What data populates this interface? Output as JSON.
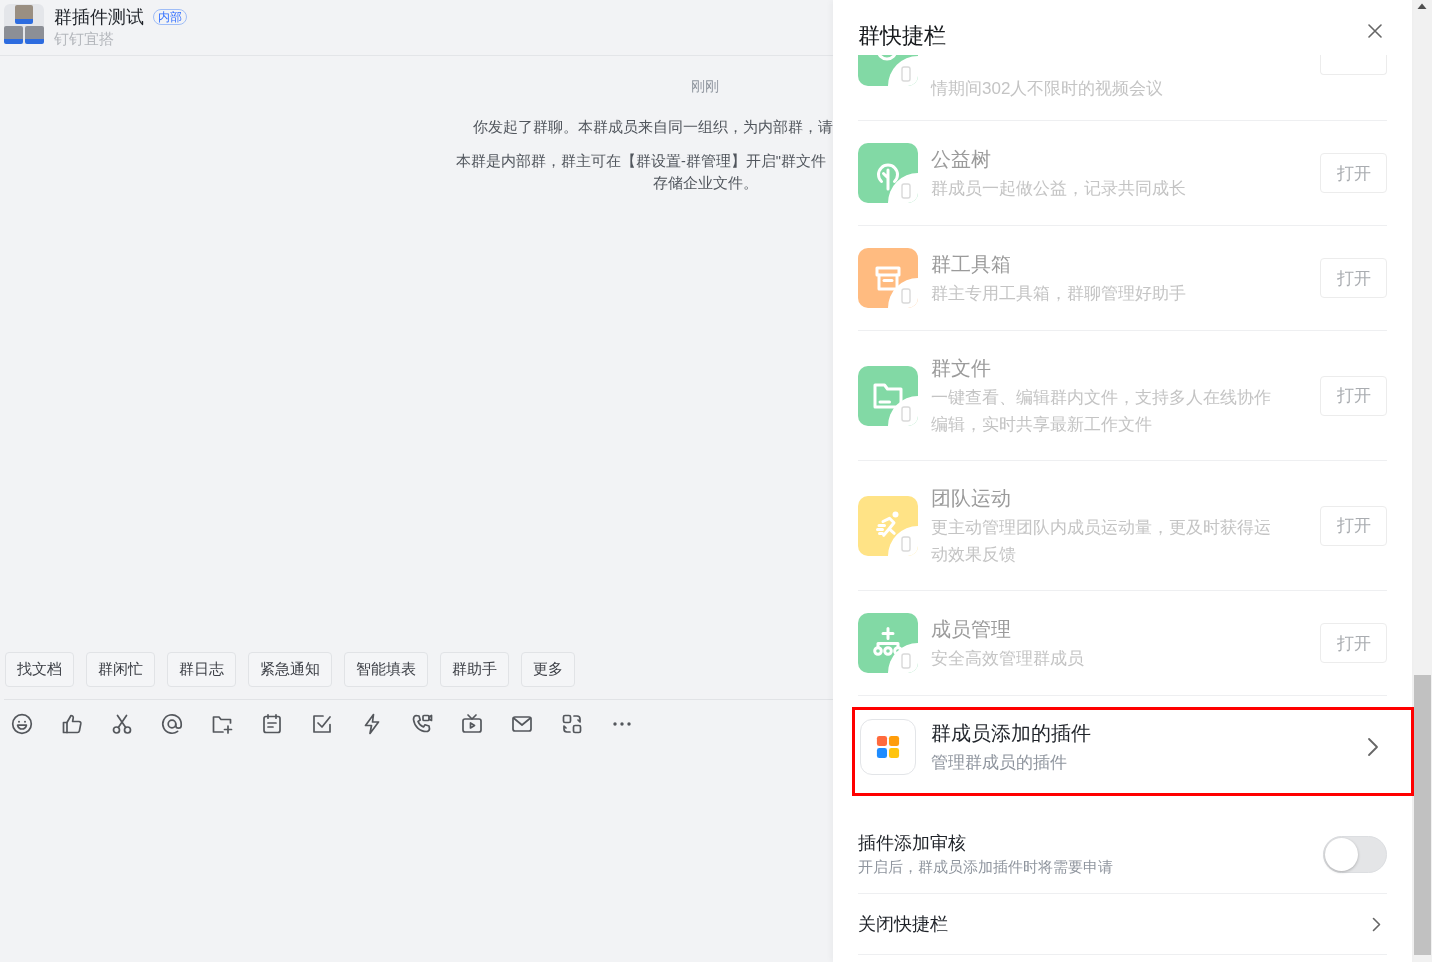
{
  "chat": {
    "header": {
      "title": "群插件测试",
      "badge": "内部",
      "subtitle": "钉钉宜搭"
    },
    "feed": {
      "time": "刚刚",
      "messages": [
        {
          "lines": [
            "你发起了群聊。本群成员来自同一组织，为内部群，请"
          ]
        },
        {
          "lines": [
            "本群是内部群，群主可在【群设置-群管理】开启\"群文件",
            "存储企业文件。"
          ]
        }
      ]
    },
    "quick_actions": [
      "找文档",
      "群闲忙",
      "群日志",
      "紧急通知",
      "智能填表",
      "群助手",
      "更多"
    ]
  },
  "drawer": {
    "title": "群快捷栏",
    "plugins": [
      {
        "kind": "partial",
        "description": "情期间302人不限时的视频会议",
        "disabled": true,
        "color": "#82d9a5"
      },
      {
        "kind": "plugin",
        "name": "公益树",
        "description": "群成员一起做公益，记录共同成长",
        "button": "打开",
        "disabled": true,
        "color": "#82d9a5"
      },
      {
        "kind": "plugin",
        "name": "群工具箱",
        "description": "群主专用工具箱，群聊管理好助手",
        "button": "打开",
        "disabled": true,
        "color": "#ffbb80"
      },
      {
        "kind": "plugin",
        "name": "群文件",
        "description": "一键查看、编辑群内文件，支持多人在线协作编辑，实时共享最新工作文件",
        "button": "打开",
        "disabled": true,
        "color": "#82d9a5"
      },
      {
        "kind": "plugin",
        "name": "团队运动",
        "description": "更主动管理团队内成员运动量，更及时获得运动效果反馈",
        "button": "打开",
        "disabled": true,
        "color": "#ffe386"
      },
      {
        "kind": "plugin",
        "name": "成员管理",
        "description": "安全高效管理群成员",
        "button": "打开",
        "disabled": true,
        "color": "#82d9a5"
      },
      {
        "kind": "link",
        "name": "群成员添加的插件",
        "description": "管理群成员的插件",
        "highlighted": true
      }
    ],
    "review_setting": {
      "label": "插件添加审核",
      "hint": "开启后，群成员添加插件时将需要申请",
      "on": false
    },
    "close_link": {
      "label": "关闭快捷栏"
    }
  }
}
